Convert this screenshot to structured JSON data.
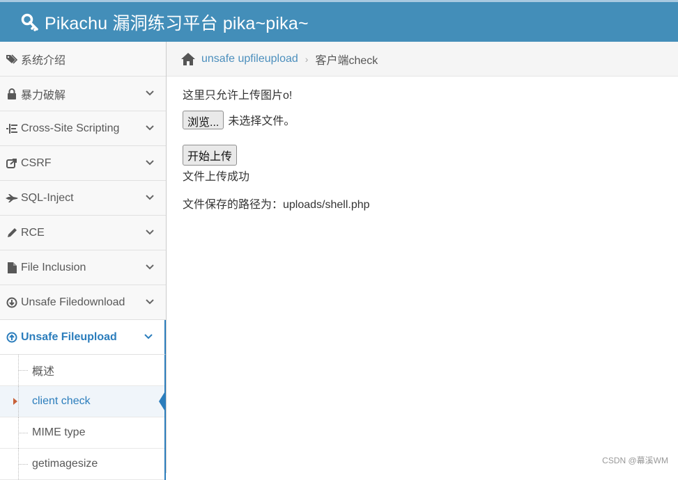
{
  "header": {
    "title": "Pikachu 漏洞练习平台 pika~pika~",
    "bg_color": "#438eb9"
  },
  "sidebar": {
    "items": [
      {
        "label": "系统介绍",
        "icon": "tags-icon",
        "expandable": false
      },
      {
        "label": "暴力破解",
        "icon": "lock-icon",
        "expandable": true
      },
      {
        "label": "Cross-Site Scripting",
        "icon": "list-icon",
        "expandable": true
      },
      {
        "label": "CSRF",
        "icon": "share-icon",
        "expandable": true
      },
      {
        "label": "SQL-Inject",
        "icon": "fighter-jet-icon",
        "expandable": true
      },
      {
        "label": "RCE",
        "icon": "pencil-icon",
        "expandable": true
      },
      {
        "label": "File Inclusion",
        "icon": "file-icon",
        "expandable": true
      },
      {
        "label": "Unsafe Filedownload",
        "icon": "download-icon",
        "expandable": true
      },
      {
        "label": "Unsafe Fileupload",
        "icon": "upload-icon",
        "expandable": true,
        "active": true
      }
    ],
    "subitems": [
      {
        "label": "概述"
      },
      {
        "label": "client check",
        "selected": true
      },
      {
        "label": "MIME type"
      },
      {
        "label": "getimagesize"
      }
    ]
  },
  "breadcrumb": {
    "link": "unsafe upfileupload",
    "current": "客户端check"
  },
  "main": {
    "notice": "这里只允许上传图片o!",
    "browse_button": "浏览...",
    "file_status": "未选择文件。",
    "upload_button": "开始上传",
    "result": "文件上传成功",
    "path_text": "文件保存的路径为：uploads/shell.php"
  },
  "watermark": "CSDN @幕溪WM",
  "colors": {
    "accent": "#2b7dbc",
    "link": "#4c8fbd",
    "caret": "#c86139"
  }
}
